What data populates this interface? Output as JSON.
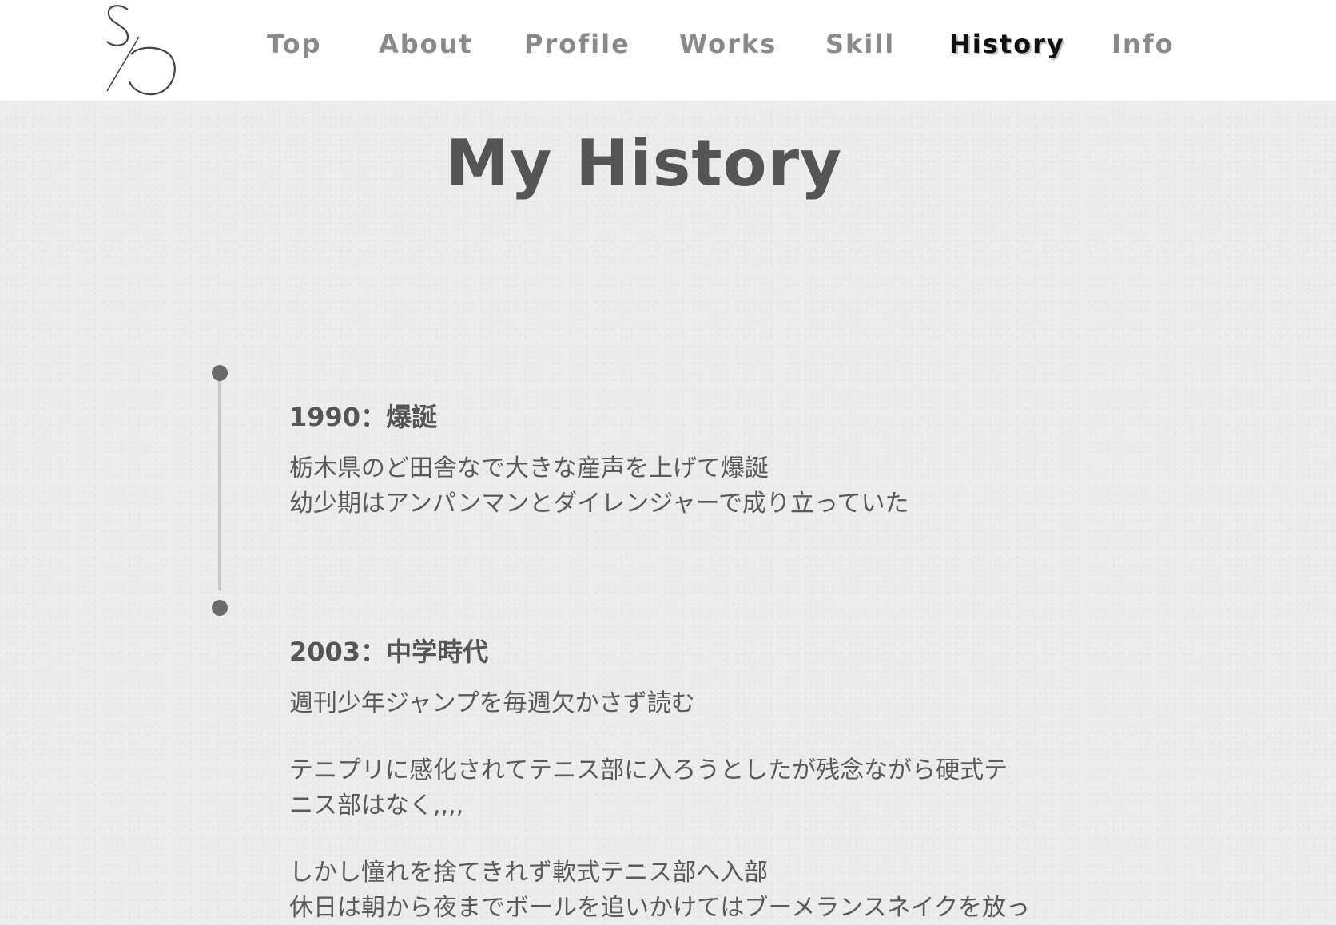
{
  "header": {
    "logo_letters": "S/O",
    "nav": [
      {
        "label": "Top",
        "active": false
      },
      {
        "label": "About",
        "active": false
      },
      {
        "label": "Profile",
        "active": false
      },
      {
        "label": "Works",
        "active": false
      },
      {
        "label": "Skill",
        "active": false
      },
      {
        "label": "History",
        "active": true
      },
      {
        "label": "Info",
        "active": false
      }
    ]
  },
  "main": {
    "title": "My History",
    "timeline": [
      {
        "heading": "1990：爆誕",
        "paragraphs": [
          [
            "栃木県のど田舎なで大きな産声を上げて爆誕",
            "幼少期はアンパンマンとダイレンジャーで成り立っていた"
          ]
        ]
      },
      {
        "heading": "2003：中学時代",
        "paragraphs": [
          [
            "週刊少年ジャンプを毎週欠かさず読む"
          ],
          [
            "テニプリに感化されてテニス部に入ろうとしたが残念ながら硬式テ",
            "ニス部はなく,,,,"
          ],
          [
            "しかし憧れを捨てきれず軟式テニス部へ入部",
            "休日は朝から夜までボールを追いかけてはブーメランスネイクを放っ"
          ]
        ]
      }
    ]
  },
  "colors": {
    "background": "#ebebeb",
    "header_bg": "#ffffff",
    "nav_inactive": "#8a8a8a",
    "nav_active": "#111111",
    "text": "#555555",
    "timeline_dot": "#6a6a6a",
    "timeline_line": "#c8c8c8"
  }
}
